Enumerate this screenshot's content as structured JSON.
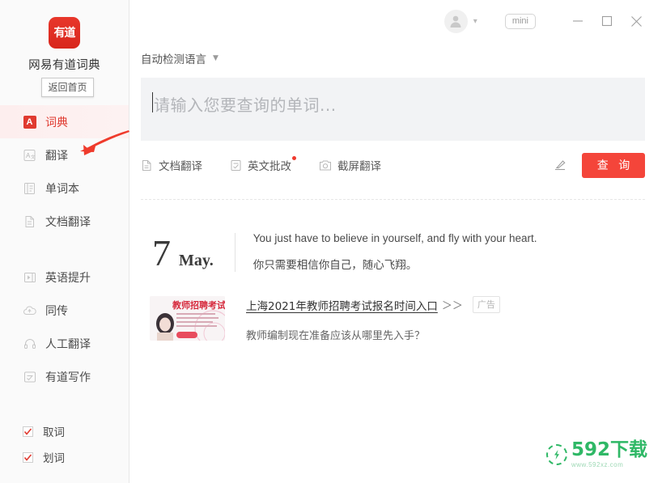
{
  "sidebar": {
    "logo_text": "有道",
    "app_name": "网易有道词典",
    "tooltip": "返回首页",
    "items": [
      {
        "label": "词典",
        "icon": "letter-a-badge-icon",
        "active": true
      },
      {
        "label": "翻译",
        "icon": "translate-icon",
        "active": false
      },
      {
        "label": "单词本",
        "icon": "notebook-icon",
        "active": false
      },
      {
        "label": "文档翻译",
        "icon": "document-icon",
        "active": false
      },
      {
        "label": "英语提升",
        "icon": "video-play-icon",
        "active": false
      },
      {
        "label": "同传",
        "icon": "cloud-interpret-icon",
        "active": false
      },
      {
        "label": "人工翻译",
        "icon": "headset-icon",
        "active": false
      },
      {
        "label": "有道写作",
        "icon": "writing-check-icon",
        "active": false
      }
    ],
    "checkboxes": [
      {
        "label": "取词",
        "checked": true
      },
      {
        "label": "划词",
        "checked": true
      }
    ]
  },
  "titlebar": {
    "avatar_icon": "user-avatar-icon",
    "chevron_icon": "chevron-down-icon",
    "mini_label": "mini",
    "minimize_icon": "minimize-icon",
    "maximize_icon": "maximize-icon",
    "close_icon": "close-icon"
  },
  "search": {
    "language_selector": "自动检测语言",
    "placeholder": "请输入您要查询的单词...",
    "value": "",
    "query_button": "查 询",
    "pen_icon": "handwriting-pen-icon"
  },
  "tools": [
    {
      "label": "文档翻译",
      "icon": "document-translate-icon",
      "dot": false
    },
    {
      "label": "英文批改",
      "icon": "proofread-icon",
      "dot": true
    },
    {
      "label": "截屏翻译",
      "icon": "screenshot-translate-icon",
      "dot": false
    }
  ],
  "daily": {
    "day": "7",
    "month": "May.",
    "quote_en": "You just have to believe in yourself, and fly with your heart.",
    "quote_cn": "你只需要相信你自己，随心飞翔。"
  },
  "ad": {
    "title": "上海2021年教师招聘考试报名时间入口",
    "arrows": "＞＞",
    "badge": "广告",
    "subtitle": "教师编制现在准备应该从哪里先入手？",
    "thumb_text": "教师招聘考试"
  },
  "watermark": {
    "main": "592下载",
    "sub": "www.592xz.com",
    "color": "#2fb866"
  },
  "colors": {
    "accent_red": "#f4453a",
    "active_red": "#e03a30",
    "input_bg": "#f2f3f5",
    "sidebar_bg": "#fafafa"
  }
}
